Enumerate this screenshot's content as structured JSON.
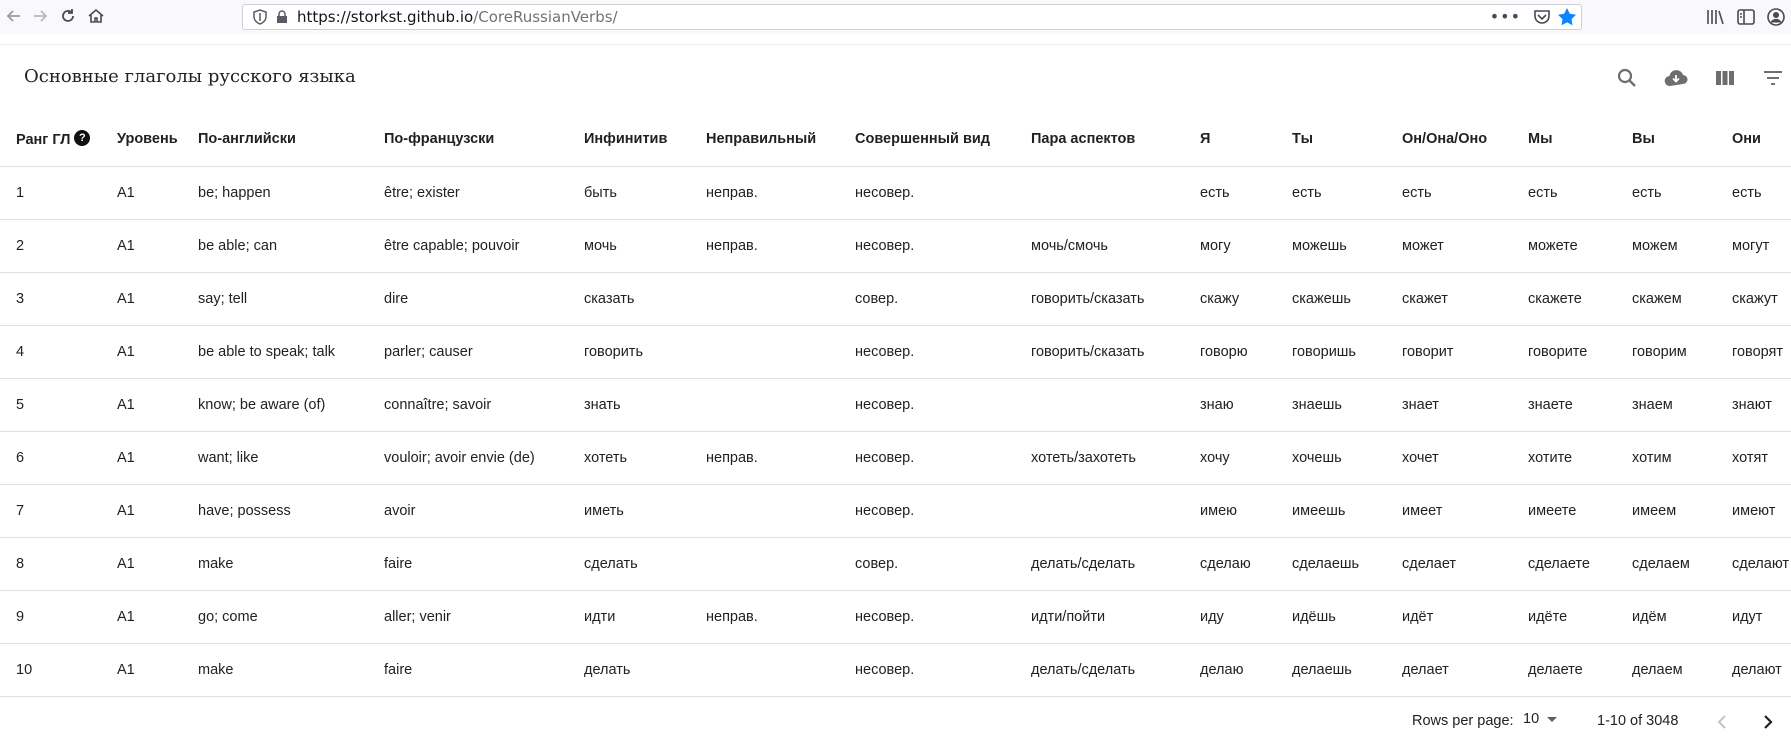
{
  "browser": {
    "url_host": "https://storkst.github.io",
    "url_path": "/CoreRussianVerbs/"
  },
  "app": {
    "title": "Основные глаголы русского языка"
  },
  "table": {
    "columns": [
      "Ранг ГЛ",
      "Уровень",
      "По-английски",
      "По-французски",
      "Инфинитив",
      "Неправильный",
      "Совершенный вид",
      "Пара аспектов",
      "Я",
      "Ты",
      "Он/Она/Оно",
      "Мы",
      "Вы",
      "Они"
    ],
    "rows": [
      [
        "1",
        "A1",
        "be; happen",
        "être; exister",
        "быть",
        "неправ.",
        "несовер.",
        "",
        "есть",
        "есть",
        "есть",
        "есть",
        "есть",
        "есть"
      ],
      [
        "2",
        "A1",
        "be able; can",
        "être capable; pouvoir",
        "мочь",
        "неправ.",
        "несовер.",
        "мочь/смочь",
        "могу",
        "можешь",
        "может",
        "можете",
        "можем",
        "могут"
      ],
      [
        "3",
        "A1",
        "say; tell",
        "dire",
        "сказать",
        "",
        "совер.",
        "говорить/сказать",
        "скажу",
        "скажешь",
        "скажет",
        "скажете",
        "скажем",
        "скажут"
      ],
      [
        "4",
        "A1",
        "be able to speak; talk",
        "parler; causer",
        "говорить",
        "",
        "несовер.",
        "говорить/сказать",
        "говорю",
        "говоришь",
        "говорит",
        "говорите",
        "говорим",
        "говорят"
      ],
      [
        "5",
        "A1",
        "know; be aware (of)",
        "connaître; savoir",
        "знать",
        "",
        "несовер.",
        "",
        "знаю",
        "знаешь",
        "знает",
        "знаете",
        "знаем",
        "знают"
      ],
      [
        "6",
        "A1",
        "want; like",
        "vouloir; avoir envie (de)",
        "хотеть",
        "неправ.",
        "несовер.",
        "хотеть/захотеть",
        "хочу",
        "хочешь",
        "хочет",
        "хотите",
        "хотим",
        "хотят"
      ],
      [
        "7",
        "A1",
        "have; possess",
        "avoir",
        "иметь",
        "",
        "несовер.",
        "",
        "имею",
        "имеешь",
        "имеет",
        "имеете",
        "имеем",
        "имеют"
      ],
      [
        "8",
        "A1",
        "make",
        "faire",
        "сделать",
        "",
        "совер.",
        "делать/сделать",
        "сделаю",
        "сделаешь",
        "сделает",
        "сделаете",
        "сделаем",
        "сделают"
      ],
      [
        "9",
        "A1",
        "go; come",
        "aller; venir",
        "идти",
        "неправ.",
        "несовер.",
        "идти/пойти",
        "иду",
        "идёшь",
        "идёт",
        "идёте",
        "идём",
        "идут"
      ],
      [
        "10",
        "A1",
        "make",
        "faire",
        "делать",
        "",
        "несовер.",
        "делать/сделать",
        "делаю",
        "делаешь",
        "делает",
        "делаете",
        "делаем",
        "делают"
      ]
    ]
  },
  "pagination": {
    "rows_per_page_label": "Rows per page:",
    "rows_per_page_value": "10",
    "range_text": "1-10 of 3048"
  },
  "colors": {
    "star": "#0a84ff",
    "border": "#e0e0e0"
  }
}
